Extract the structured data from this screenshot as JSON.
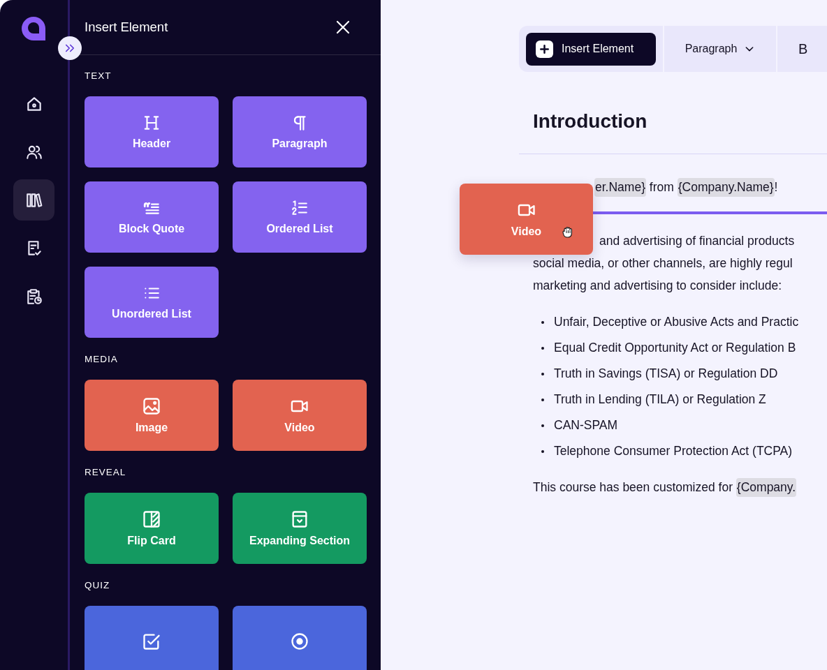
{
  "rail": {
    "items": [
      {
        "kind": "home",
        "selected": false
      },
      {
        "kind": "users",
        "selected": false
      },
      {
        "kind": "library",
        "selected": true
      },
      {
        "kind": "document-check",
        "selected": false
      },
      {
        "kind": "clipboard-clock",
        "selected": false
      }
    ]
  },
  "panel": {
    "title": "Insert Element",
    "sections": [
      {
        "heading": "TEXT",
        "color": "#8463ef",
        "items": [
          {
            "kind": "header",
            "label": "Header"
          },
          {
            "kind": "paragraph",
            "label": "Paragraph"
          },
          {
            "kind": "quote",
            "label": "Block Quote"
          },
          {
            "kind": "ordered-list",
            "label": "Ordered List"
          },
          {
            "kind": "unordered-list",
            "label": "Unordered List"
          }
        ]
      },
      {
        "heading": "MEDIA",
        "color": "#e26350",
        "items": [
          {
            "kind": "image",
            "label": "Image"
          },
          {
            "kind": "video",
            "label": "Video"
          }
        ]
      },
      {
        "heading": "REVEAL",
        "color": "#149a61",
        "items": [
          {
            "kind": "flip-card",
            "label": "Flip Card"
          },
          {
            "kind": "expanding-section",
            "label": "Expanding Section"
          }
        ]
      },
      {
        "heading": "QUIZ",
        "color": "#4b66dc",
        "items": [
          {
            "kind": "checkbox"
          },
          {
            "kind": "radio"
          }
        ]
      }
    ]
  },
  "editor": {
    "toolbar": {
      "insert_button": "Insert Element",
      "style_dropdown": "Paragraph",
      "bold_button": "B"
    },
    "heading": "Introduction",
    "greeting": [
      {
        "kind": "variable",
        "text": "er.Name}"
      },
      {
        "kind": "text",
        "text": " from "
      },
      {
        "kind": "variable",
        "text": "{Company.Name}"
      },
      {
        "kind": "text",
        "text": "!"
      }
    ],
    "intro_lines": [
      "and advertising of financial products",
      "social media, or other channels, are highly regul",
      "marketing and advertising to consider include:"
    ],
    "bullets": [
      "Unfair, Deceptive or Abusive Acts and Practic",
      "Equal Credit Opportunity Act or Regulation B",
      "Truth in Savings (TISA) or Regulation DD",
      "Truth in Lending (TILA) or Regulation Z",
      "CAN-SPAM",
      "Telephone Consumer Protection Act (TCPA)"
    ],
    "closing": [
      {
        "kind": "text",
        "text": "This course has been customized for "
      },
      {
        "kind": "variable",
        "text": "{Company."
      }
    ]
  },
  "drag_preview": {
    "kind": "video",
    "label": "Video"
  }
}
